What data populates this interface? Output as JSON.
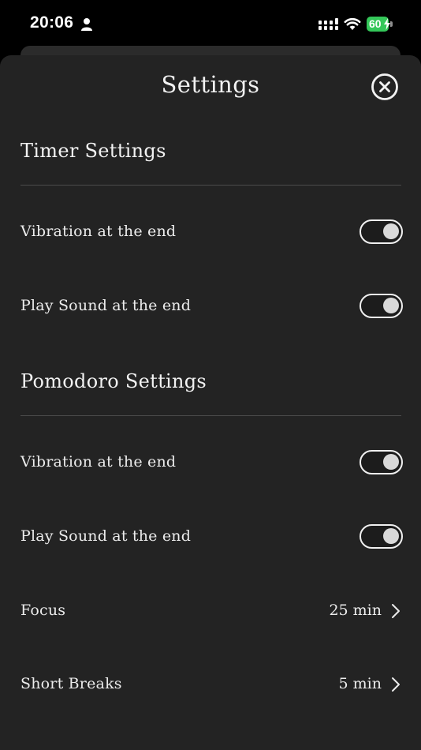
{
  "status_bar": {
    "time": "20:06",
    "battery_level": "60",
    "icons": [
      "person-icon",
      "signal-icon",
      "wifi-icon",
      "battery-charging-icon"
    ]
  },
  "sheet": {
    "title": "Settings",
    "close_icon": "close-circle-icon"
  },
  "sections": {
    "timer": {
      "header": "Timer Settings",
      "rows": [
        {
          "label": "Vibration at the end",
          "toggle_on": true
        },
        {
          "label": "Play Sound at the end",
          "toggle_on": true
        }
      ]
    },
    "pomodoro": {
      "header": "Pomodoro Settings",
      "rows": [
        {
          "label": "Vibration at the end",
          "toggle_on": true
        },
        {
          "label": "Play Sound at the end",
          "toggle_on": true
        },
        {
          "label": "Focus",
          "value": "25 min"
        },
        {
          "label": "Short Breaks",
          "value": "5 min"
        }
      ]
    }
  },
  "colors": {
    "background": "#000000",
    "sheet": "#232323",
    "text": "#f2f2f2",
    "battery": "#34c759"
  }
}
